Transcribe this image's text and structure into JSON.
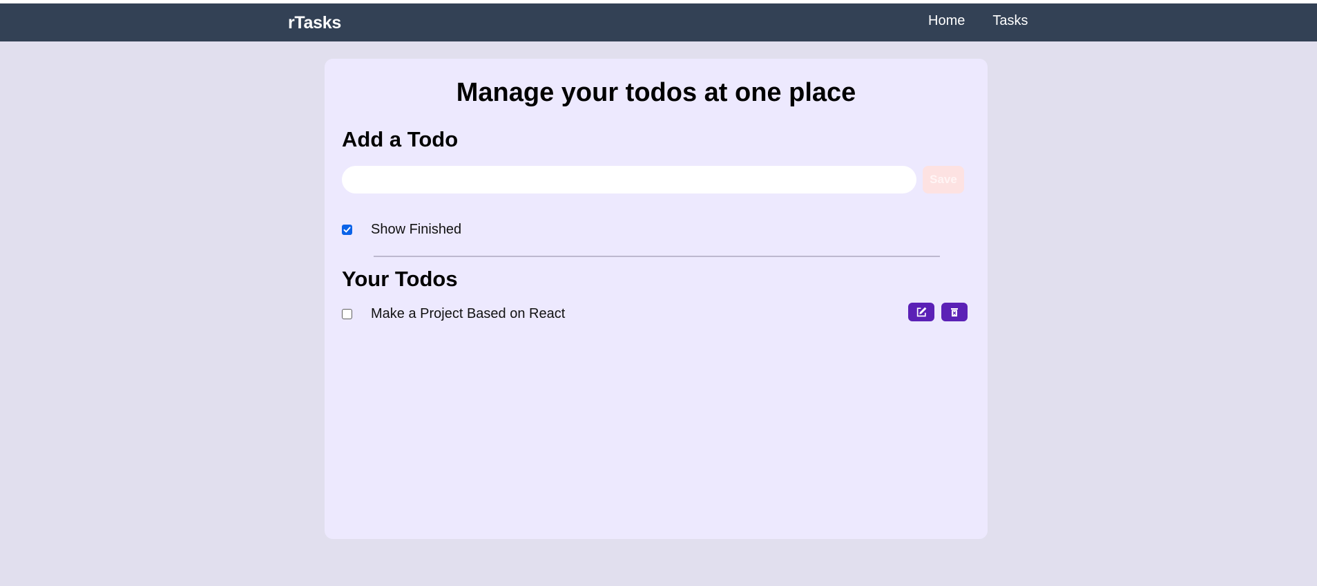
{
  "navbar": {
    "brand": "rTasks",
    "links": [
      {
        "label": "Home"
      },
      {
        "label": "Tasks"
      }
    ]
  },
  "main": {
    "title": "Manage your todos at one place",
    "add_section": {
      "heading": "Add a Todo",
      "input_value": "",
      "save_label": "Save"
    },
    "show_finished": {
      "label": "Show Finished",
      "checked": true
    },
    "todos_section": {
      "heading": "Your Todos",
      "items": [
        {
          "text": "Make a Project Based on React",
          "completed": false,
          "actions": [
            "edit-icon",
            "trash-icon"
          ]
        }
      ]
    }
  },
  "colors": {
    "navbar_bg": "#334155",
    "page_bg": "#e1dfee",
    "card_bg": "#ede9fe",
    "action_button": "#5b21b6",
    "save_button_disabled": "#fde2e2",
    "checkbox_accent": "#0b63e8"
  }
}
